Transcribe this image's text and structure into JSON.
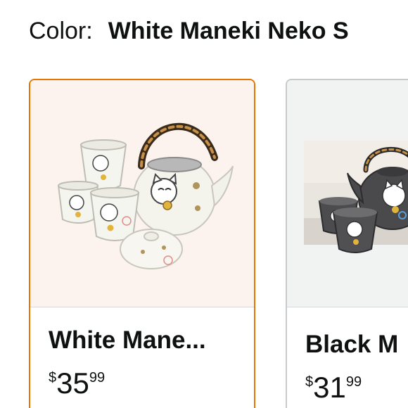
{
  "variation": {
    "label": "Color:",
    "selected_value": "White Maneki Neko S"
  },
  "options": [
    {
      "title": "White Mane...",
      "price": {
        "symbol": "$",
        "whole": "35",
        "fraction": "99"
      },
      "selected": true,
      "image_icon": "white-maneki-neko-tea-set-photo"
    },
    {
      "title": "Black M",
      "price": {
        "symbol": "$",
        "whole": "31",
        "fraction": "99"
      },
      "selected": false,
      "image_icon": "black-maneki-neko-tea-set-photo"
    }
  ],
  "colors": {
    "selected_border": "#e77600",
    "unselected_border": "#c7c9cc",
    "text": "#0f1111"
  }
}
